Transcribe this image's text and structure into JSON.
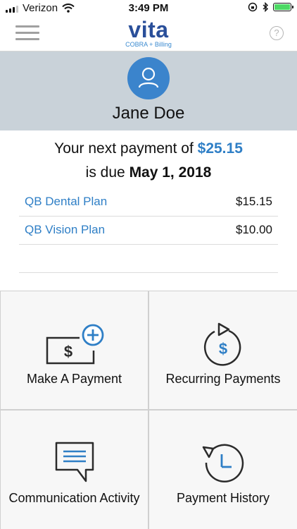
{
  "status_bar": {
    "carrier": "Verizon",
    "time": "3:49 PM"
  },
  "header": {
    "logo_text": "vita",
    "logo_subtitle": "COBRA + Billing",
    "help_glyph": "?",
    "menu_icon": "hamburger-icon",
    "help_icon": "question-circle-icon"
  },
  "profile": {
    "name": "Jane Doe",
    "avatar_icon": "user-icon"
  },
  "payment": {
    "prefix": "Your next payment of",
    "amount": "$25.15",
    "due_prefix": "is due",
    "due_date": "May 1, 2018"
  },
  "plans": [
    {
      "name": "QB Dental Plan",
      "amount": "$15.15"
    },
    {
      "name": "QB Vision Plan",
      "amount": "$10.00"
    }
  ],
  "tiles": [
    {
      "label": "Make A Payment",
      "icon": "add-payment-icon"
    },
    {
      "label": "Recurring Payments",
      "icon": "recurring-payment-icon"
    },
    {
      "label": "Communication Activity",
      "icon": "chat-bubble-icon"
    },
    {
      "label": "Payment History",
      "icon": "history-clock-icon"
    }
  ],
  "colors": {
    "accent": "#2f7fc6",
    "brand": "#2a4f9a",
    "band": "#c9d2d9",
    "battery": "#4cd964"
  }
}
